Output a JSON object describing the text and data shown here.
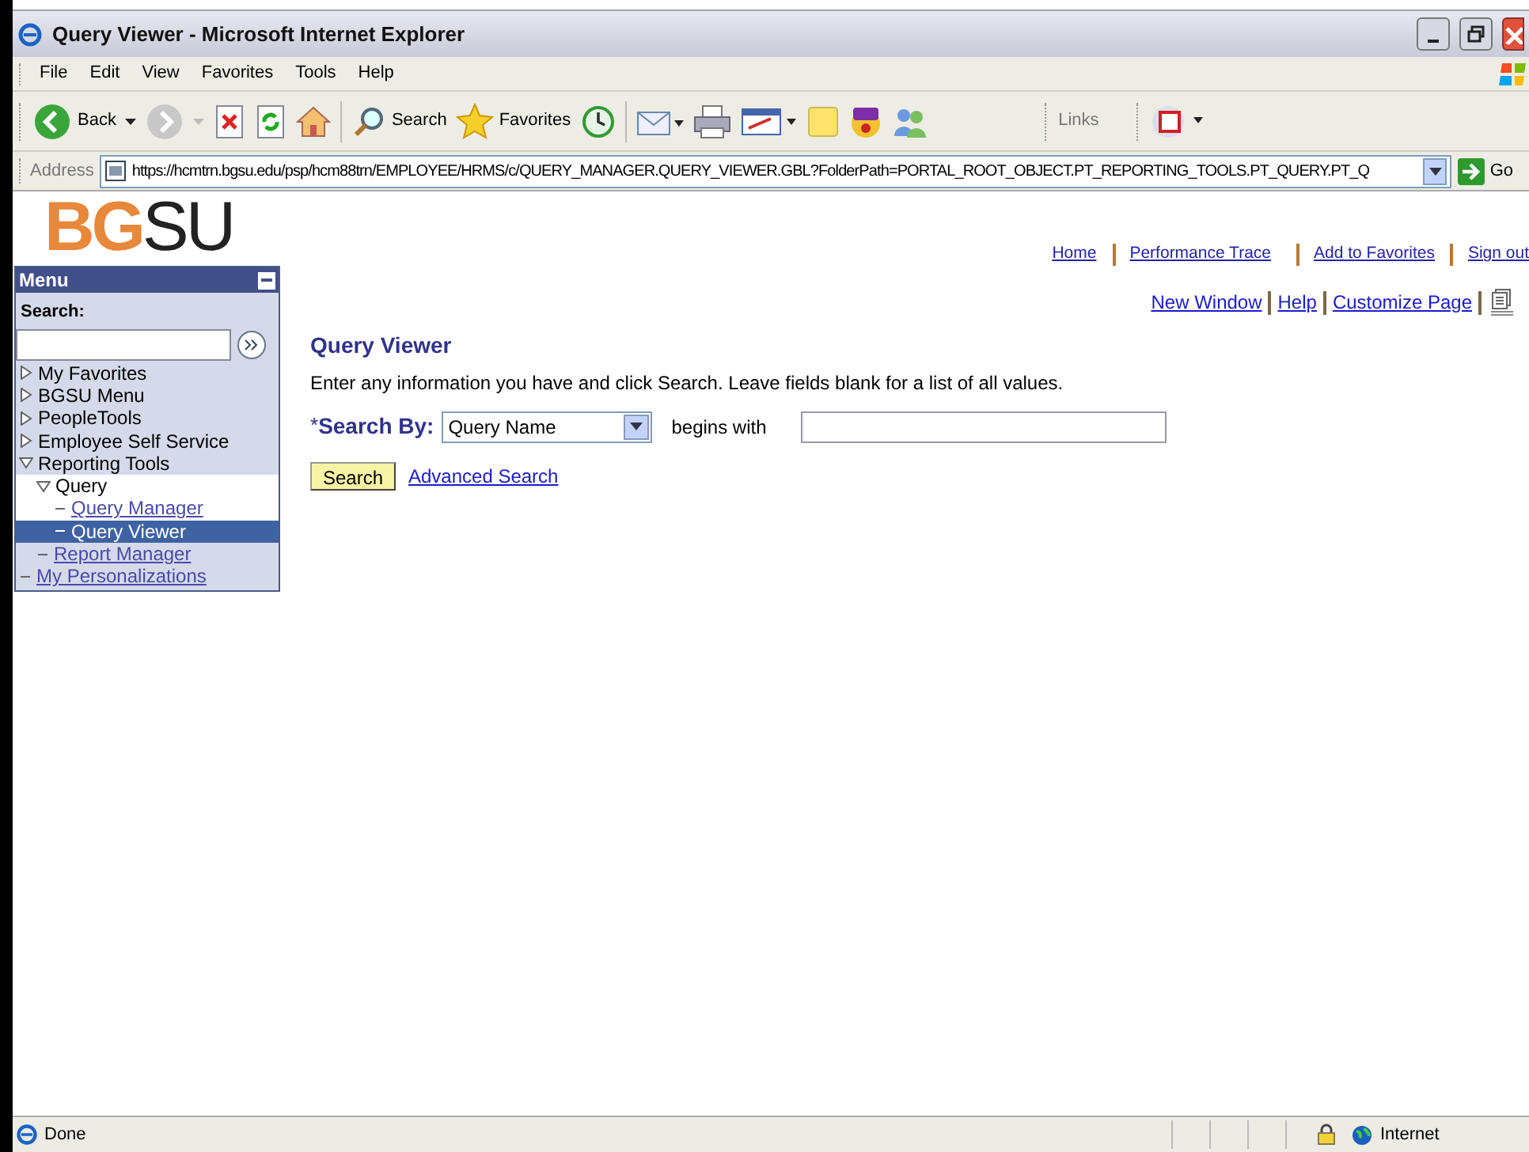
{
  "window": {
    "title": "Query Viewer - Microsoft Internet Explorer"
  },
  "menu_bar": [
    "File",
    "Edit",
    "View",
    "Favorites",
    "Tools",
    "Help"
  ],
  "toolbar": {
    "back": "Back",
    "search": "Search",
    "favorites": "Favorites",
    "links": "Links"
  },
  "address_bar": {
    "label": "Address",
    "url": "https://hcmtrn.bgsu.edu/psp/hcm88trn/EMPLOYEE/HRMS/c/QUERY_MANAGER.QUERY_VIEWER.GBL?FolderPath=PORTAL_ROOT_OBJECT.PT_REPORTING_TOOLS.PT_QUERY.PT_Q",
    "go": "Go"
  },
  "logo": {
    "part_1": "BG",
    "part_2": "SU"
  },
  "header_links": [
    "Home",
    "Performance Trace",
    "Add to Favorites",
    "Sign out"
  ],
  "page_links": [
    "New Window",
    "Help",
    "Customize Page"
  ],
  "sidebar": {
    "title": "Menu",
    "search_label": "Search:",
    "items": [
      {
        "label": "My Favorites",
        "kind": "folder",
        "expanded": false,
        "selected": false
      },
      {
        "label": "BGSU Menu",
        "kind": "folder",
        "expanded": false,
        "selected": false
      },
      {
        "label": "PeopleTools",
        "kind": "folder",
        "expanded": false,
        "selected": false
      },
      {
        "label": "Employee Self Service",
        "kind": "folder",
        "expanded": false,
        "selected": false
      },
      {
        "label": "Reporting Tools",
        "kind": "folder",
        "expanded": true,
        "selected": false,
        "children": [
          {
            "label": "Query",
            "kind": "folder",
            "expanded": true,
            "selected": false,
            "children": [
              {
                "label": "Query Manager",
                "kind": "link",
                "selected": false
              },
              {
                "label": "Query Viewer",
                "kind": "link",
                "selected": true
              }
            ]
          },
          {
            "label": "Report Manager",
            "kind": "link",
            "selected": false
          }
        ]
      },
      {
        "label": "My Personalizations",
        "kind": "link",
        "selected": false
      }
    ]
  },
  "main": {
    "title": "Query Viewer",
    "instructions": "Enter any information you have and click Search. Leave fields blank for a list of all values.",
    "required_mark": "*",
    "search_by_label": "Search By:",
    "search_by_value": "Query Name",
    "operator": "begins with",
    "search_button": "Search",
    "advanced_link": "Advanced Search"
  },
  "status_bar": {
    "status": "Done",
    "zone": "Internet"
  }
}
